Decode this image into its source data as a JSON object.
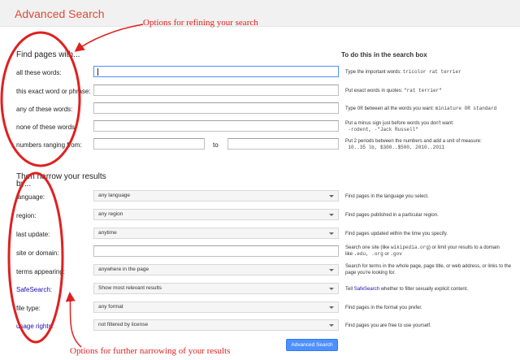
{
  "page_title": "Advanced Search",
  "annotations": {
    "top": "Options for refining your search",
    "bottom": "Options for further narrowing of your results"
  },
  "find_section": {
    "heading": "Find pages with...",
    "hint_heading": "To do this in the search box",
    "rows": [
      {
        "label": "all these words:",
        "hint": "Type the important words:",
        "hint_code": "tricolor rat terrier"
      },
      {
        "label": "this exact word or phrase:",
        "hint": "Put exact words in quotes:",
        "hint_code": "\"rat terrier\""
      },
      {
        "label": "any of these words:",
        "hint_pre": "Type",
        "hint_code_inline": "OR",
        "hint": "between all the words you want:",
        "hint_code": "miniature OR standard"
      },
      {
        "label": "none of these words:",
        "hint": "Put a minus sign just before words you don't want:",
        "hint_code": "-rodent, -\"Jack Russell\""
      },
      {
        "label": "numbers ranging from:",
        "to_label": "to",
        "hint": "Put 2 periods between the numbers and add a unit of measure:",
        "hint_code": "10..35 lb, $300..$500, 2010..2011"
      }
    ]
  },
  "narrow_section": {
    "heading": "Then narrow your results",
    "heading_line2": "by...",
    "rows": [
      {
        "label": "language:",
        "value": "any language",
        "hint": "Find pages in the language you select."
      },
      {
        "label": "region:",
        "value": "any region",
        "hint": "Find pages published in a particular region."
      },
      {
        "label": "last update:",
        "value": "anytime",
        "hint": "Find pages updated within the time you specify."
      },
      {
        "label": "site or domain:",
        "hint_a": "Search one site (like",
        "hint_code1": "wikipedia.org",
        "hint_b": ") or limit your results to a domain",
        "hint_c": "like",
        "hint_code2": ".edu, .org",
        "hint_d": "or",
        "hint_code3": ".gov"
      },
      {
        "label": "terms appearing:",
        "value": "anywhere in the page",
        "hint": "Search for terms in the whole page, page title, or web address, or links to the page you're looking for."
      },
      {
        "label": "SafeSearch:",
        "value": "Show most relevant results",
        "hint_a": "Tell",
        "hint_link": "SafeSearch",
        "hint_b": "whether to filter sexually explicit content."
      },
      {
        "label": "file type:",
        "value": "any format",
        "hint": "Find pages in the format you prefer."
      },
      {
        "label": "usage rights:",
        "value": "not filtered by license",
        "hint": "Find pages you are free to use yourself."
      }
    ]
  },
  "submit_label": "Advanced Search",
  "colors": {
    "accent_red": "#dd4b39",
    "annotation_red": "#e02020",
    "button_blue": "#4d90fe",
    "link_blue": "#1a0dab"
  }
}
